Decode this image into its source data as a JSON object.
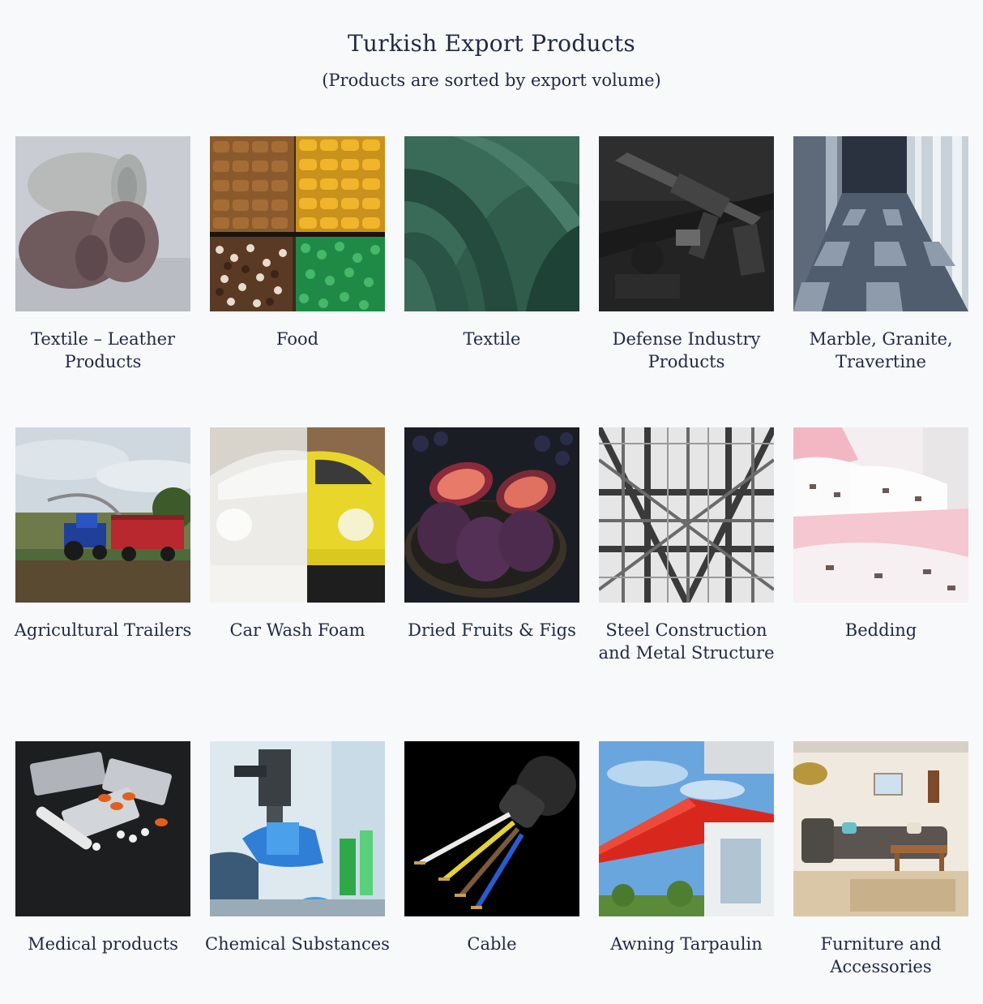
{
  "page": {
    "title": "Turkish Export Products",
    "subtitle": "(Products are sorted by export volume)"
  },
  "products": [
    {
      "label": "Textile – Leather Products",
      "image": "towels-photo"
    },
    {
      "label": "Food",
      "image": "nuts-and-sweets-photo"
    },
    {
      "label": "Textile",
      "image": "green-fabric-photo"
    },
    {
      "label": "Defense Industry Products",
      "image": "rifle-photo"
    },
    {
      "label": "Marble, Granite, Travertine",
      "image": "marble-hall-photo"
    },
    {
      "label": "Agricultural Trailers",
      "image": "tractor-trailer-photo"
    },
    {
      "label": "Car Wash Foam",
      "image": "foamed-car-photo"
    },
    {
      "label": "Dried Fruits & Figs",
      "image": "figs-bowl-photo"
    },
    {
      "label": "Steel Construction and Metal Structure",
      "image": "steel-frame-photo"
    },
    {
      "label": "Bedding",
      "image": "bed-linen-photo"
    },
    {
      "label": "Medical products",
      "image": "pills-thermometer-photo"
    },
    {
      "label": "Chemical Substances",
      "image": "lab-flask-photo"
    },
    {
      "label": "Cable",
      "image": "electric-cable-photo"
    },
    {
      "label": "Awning Tarpaulin",
      "image": "red-awning-photo"
    },
    {
      "label": "Furniture and Accessories",
      "image": "living-room-photo"
    }
  ]
}
